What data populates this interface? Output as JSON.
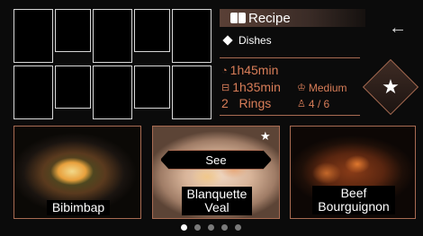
{
  "recipe": {
    "title": "Recipe",
    "category": "Dishes",
    "total_time": "1h45min",
    "cook_time": "1h35min",
    "difficulty": "Medium",
    "rings": "2   Rings",
    "servings": "4 / 6"
  },
  "cards": [
    {
      "label": "Bibimbap"
    },
    {
      "label": "Blanquette\nVeal",
      "action": "See"
    },
    {
      "label": "Beef\nBourguignon"
    }
  ],
  "pagination": {
    "total": 5,
    "active": 1
  },
  "colors": {
    "accent": "#d87d58",
    "border": "#a86b52",
    "background": "#0b0b0b"
  },
  "icons": {
    "back": "arrow-left-icon",
    "favorite": "star-icon",
    "category": "diamond-icon",
    "timer": "timer-icon",
    "cooking": "pot-icon",
    "chef": "chef-hat-icon",
    "person": "person-icon",
    "title": "book-icon"
  }
}
